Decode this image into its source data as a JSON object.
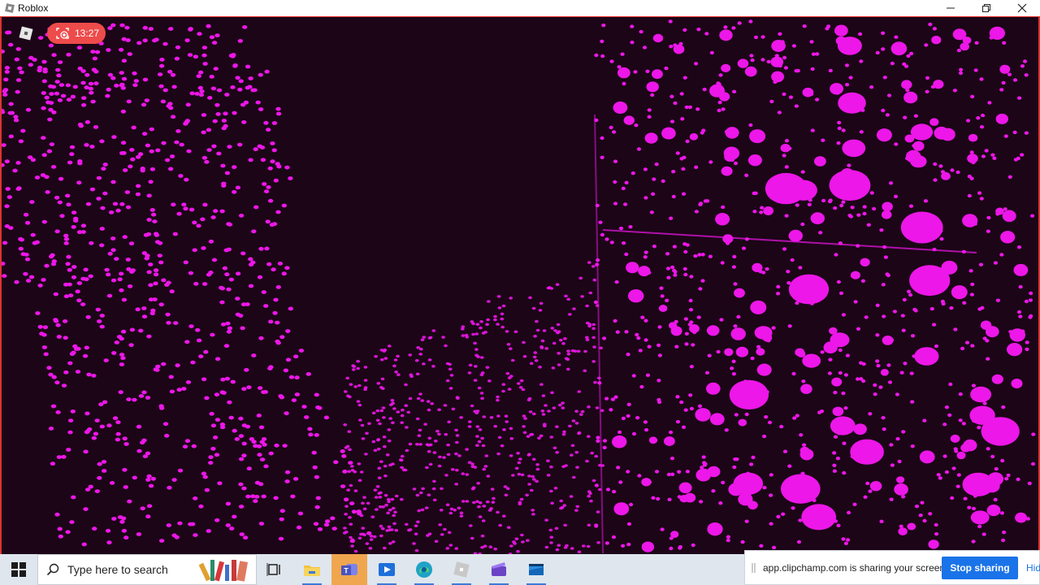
{
  "window": {
    "title": "Roblox",
    "controls": [
      "minimize",
      "restore",
      "close"
    ]
  },
  "game": {
    "menu_icon": "roblox-logo-icon",
    "recording": {
      "icon": "record-icon",
      "time": "13:27"
    },
    "scene_colors": {
      "background": "#1c0517",
      "dots": "#ec17e8"
    }
  },
  "taskbar": {
    "start_icon": "windows-logo-icon",
    "search": {
      "placeholder": "Type here to search"
    },
    "apps": [
      {
        "name": "task-view-icon"
      },
      {
        "name": "file-explorer-icon"
      },
      {
        "name": "teams-icon"
      },
      {
        "name": "media-player-icon"
      },
      {
        "name": "edge-icon"
      },
      {
        "name": "roblox-icon"
      },
      {
        "name": "clipchamp-icon"
      },
      {
        "name": "roblox-studio-icon"
      }
    ]
  },
  "sharing_bar": {
    "message": "app.clipchamp.com is sharing your screen.",
    "stop_label": "Stop sharing",
    "hide_label": "Hide"
  }
}
